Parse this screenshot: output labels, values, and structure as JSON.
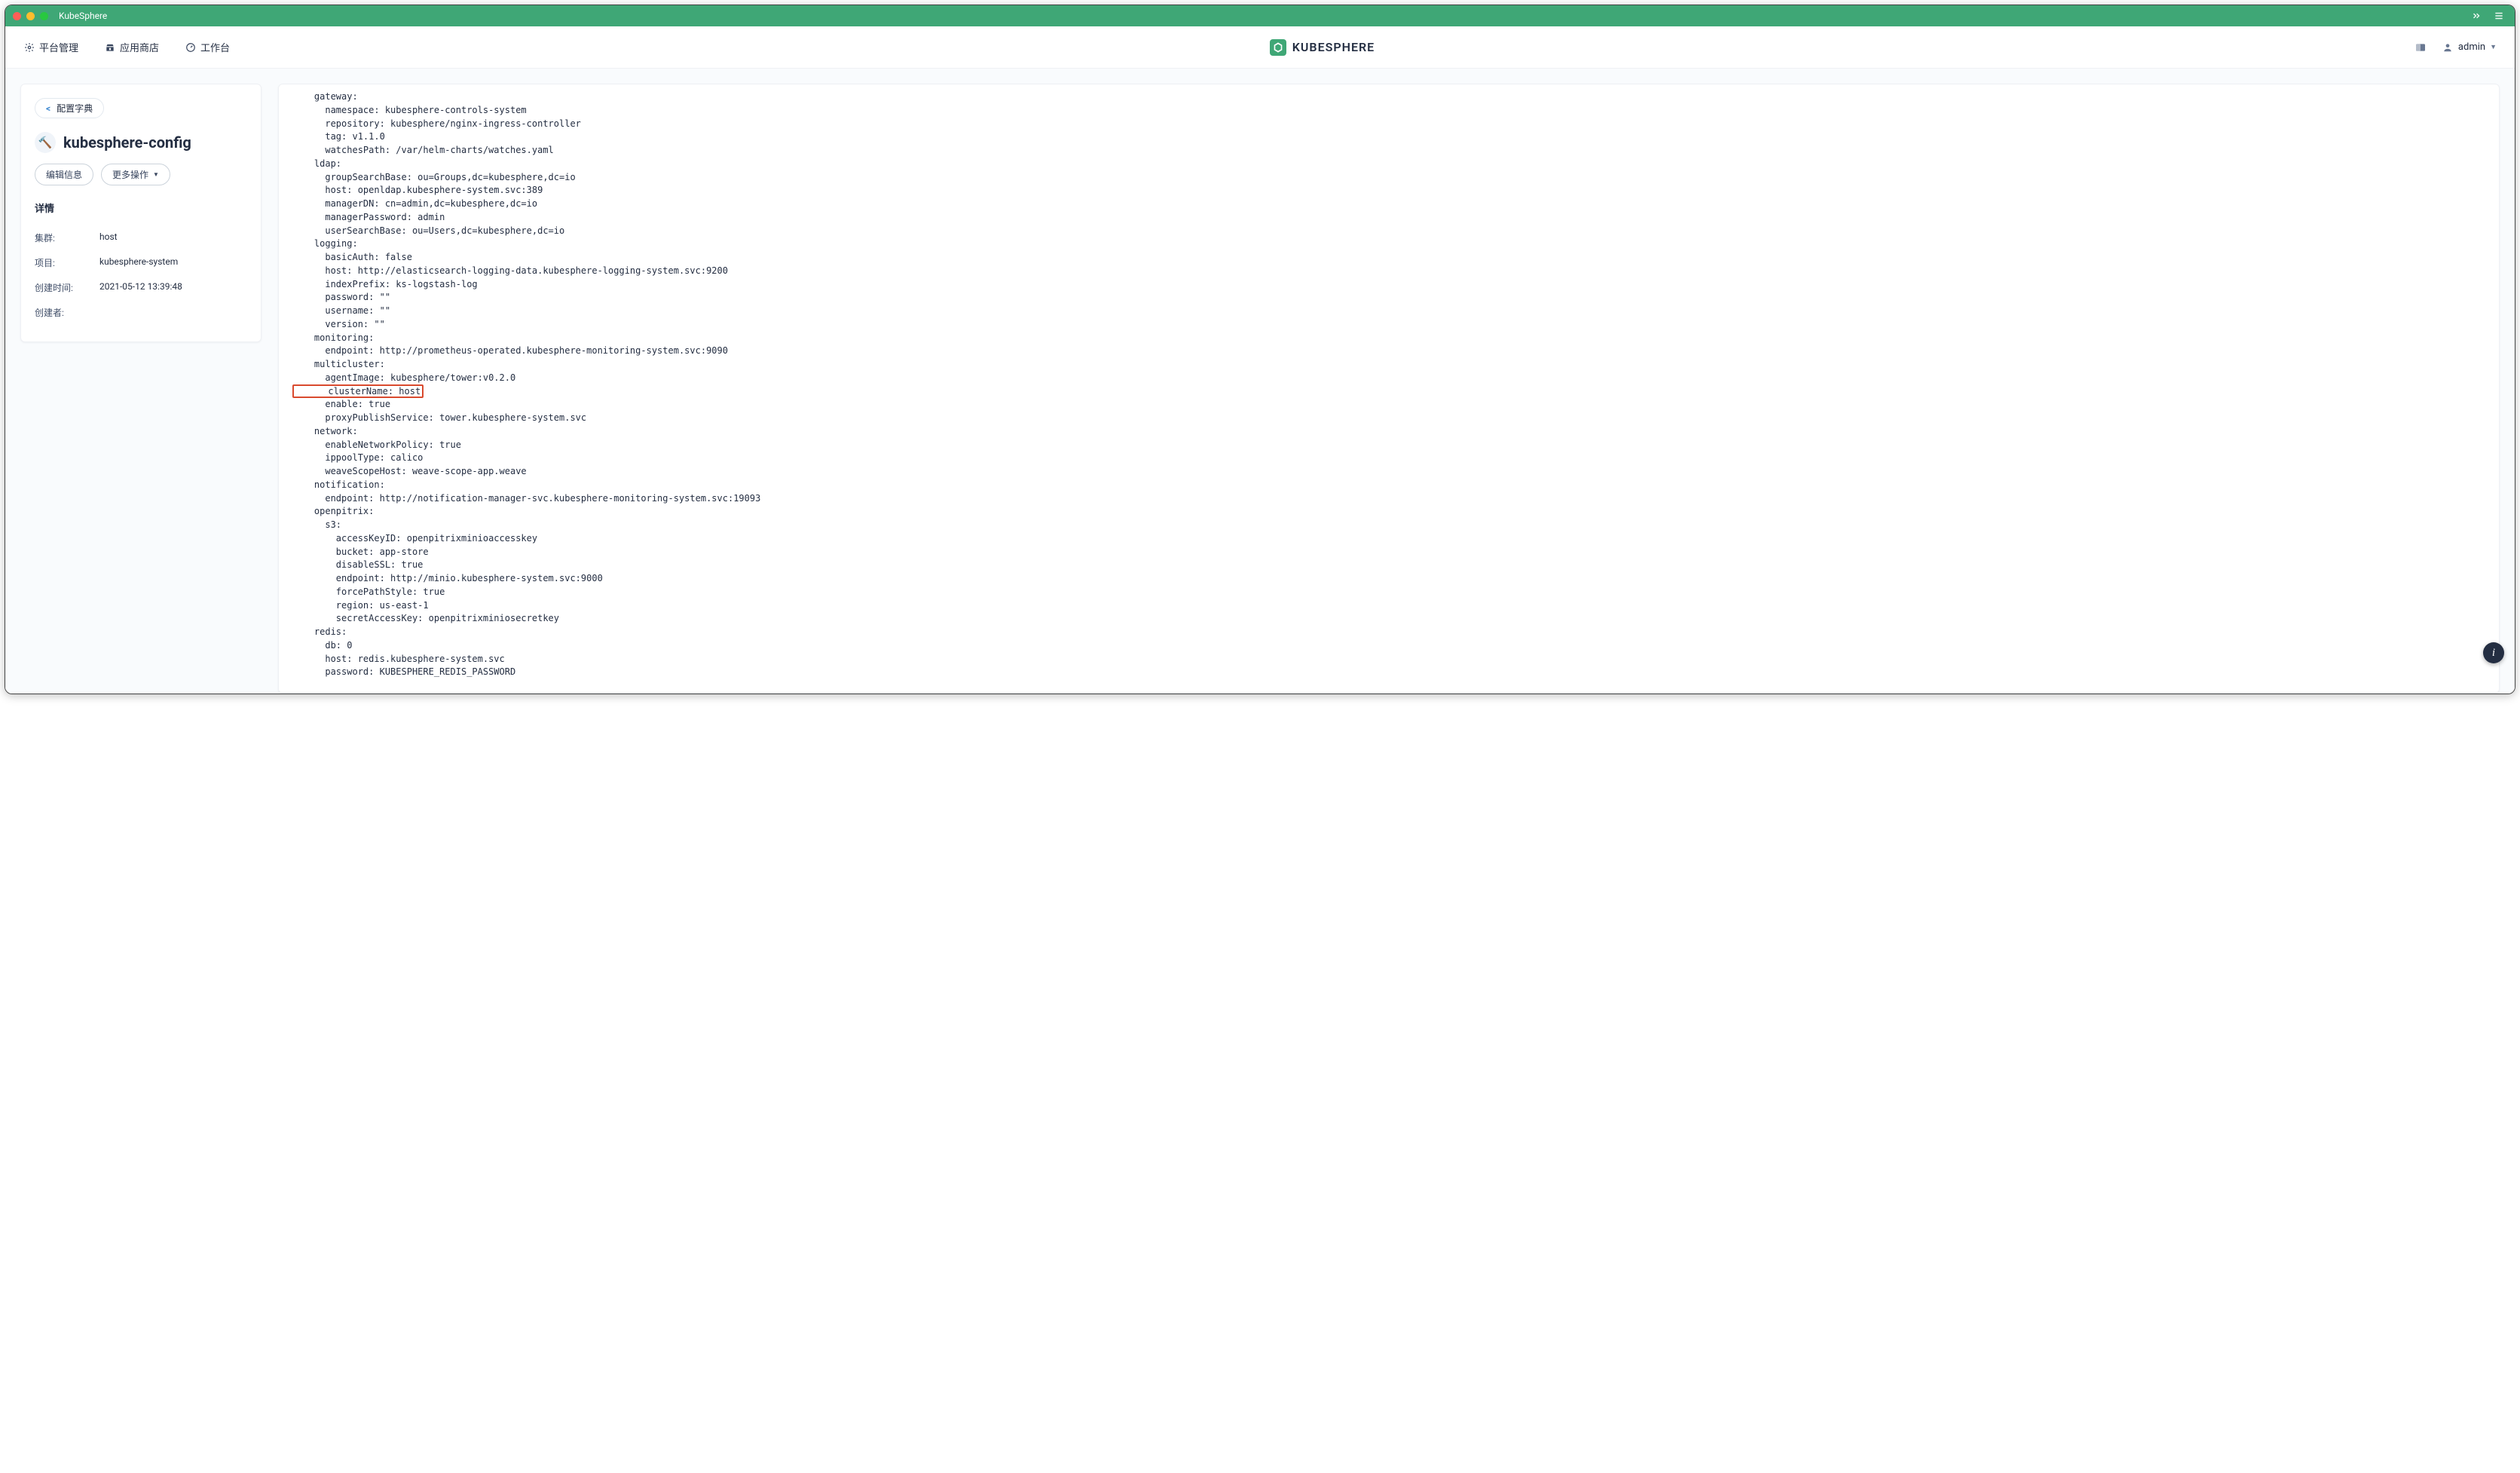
{
  "titleBar": {
    "appName": "KubeSphere"
  },
  "nav": {
    "platform": "平台管理",
    "appStore": "应用商店",
    "workspace": "工作台",
    "brand": "KUBESPHERE",
    "user": "admin"
  },
  "side": {
    "back": "配置字典",
    "title": "kubesphere-config",
    "editBtn": "编辑信息",
    "moreBtn": "更多操作",
    "detailTitle": "详情",
    "info": {
      "clusterLabel": "集群:",
      "clusterValue": "host",
      "projectLabel": "项目:",
      "projectValue": "kubesphere-system",
      "createdLabel": "创建时间:",
      "createdValue": "2021-05-12 13:39:48",
      "creatorLabel": "创建者:",
      "creatorValue": ""
    }
  },
  "code": {
    "pre1": "    gateway:\n      namespace: kubesphere-controls-system\n      repository: kubesphere/nginx-ingress-controller\n      tag: v1.1.0\n      watchesPath: /var/helm-charts/watches.yaml\n    ldap:\n      groupSearchBase: ou=Groups,dc=kubesphere,dc=io\n      host: openldap.kubesphere-system.svc:389\n      managerDN: cn=admin,dc=kubesphere,dc=io\n      managerPassword: admin\n      userSearchBase: ou=Users,dc=kubesphere,dc=io\n    logging:\n      basicAuth: false\n      host: http://elasticsearch-logging-data.kubesphere-logging-system.svc:9200\n      indexPrefix: ks-logstash-log\n      password: \"\"\n      username: \"\"\n      version: \"\"\n    monitoring:\n      endpoint: http://prometheus-operated.kubesphere-monitoring-system.svc:9090\n    multicluster:\n      agentImage: kubesphere/tower:v0.2.0",
    "hl": "      clusterName: host",
    "pre2": "      enable: true\n      proxyPublishService: tower.kubesphere-system.svc\n    network:\n      enableNetworkPolicy: true\n      ippoolType: calico\n      weaveScopeHost: weave-scope-app.weave\n    notification:\n      endpoint: http://notification-manager-svc.kubesphere-monitoring-system.svc:19093\n    openpitrix:\n      s3:\n        accessKeyID: openpitrixminioaccesskey\n        bucket: app-store\n        disableSSL: true\n        endpoint: http://minio.kubesphere-system.svc:9000\n        forcePathStyle: true\n        region: us-east-1\n        secretAccessKey: openpitrixminiosecretkey\n    redis:\n      db: 0\n      host: redis.kubesphere-system.svc\n      password: KUBESPHERE_REDIS_PASSWORD"
  },
  "help": {
    "label": "i"
  }
}
